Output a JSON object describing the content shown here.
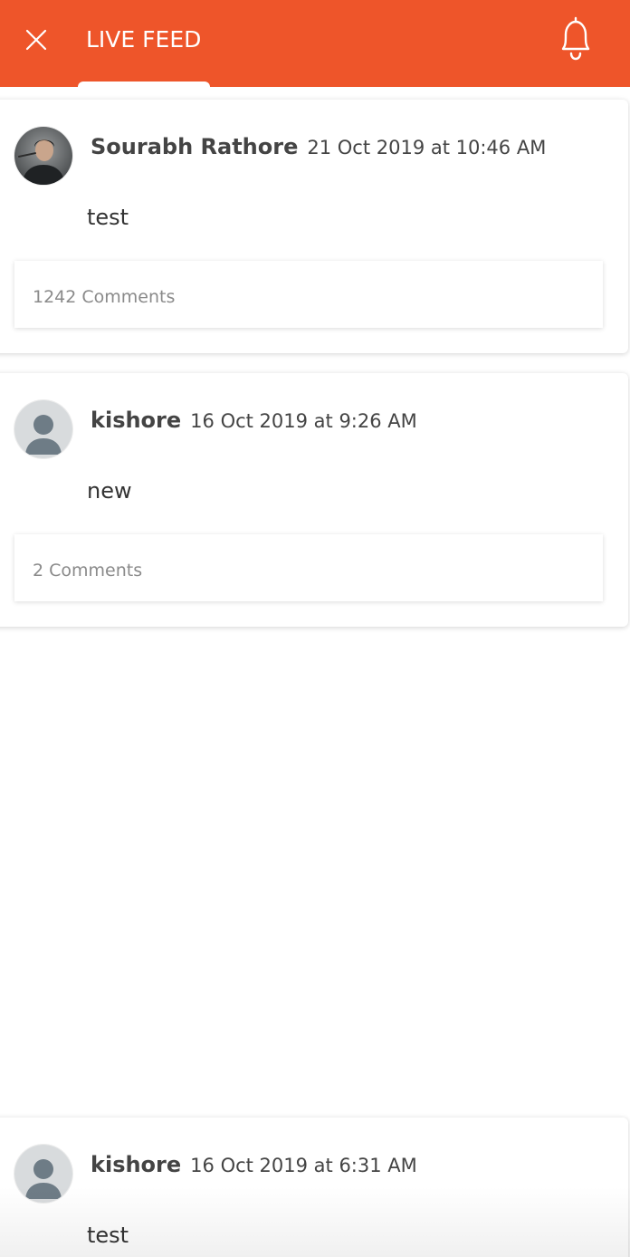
{
  "header": {
    "title": "LIVE FEED",
    "close_icon": "close-icon",
    "bell_icon": "bell-icon",
    "background": "#EE552A"
  },
  "feed": {
    "posts": [
      {
        "author": "Sourabh Rathore",
        "timestamp": "21 Oct 2019 at 10:46 AM",
        "text": "test",
        "comments": "1242 Comments",
        "avatar": "user-photo"
      },
      {
        "author": "kishore",
        "timestamp": "16 Oct 2019 at 9:26 AM",
        "text": "new",
        "comments": "2 Comments",
        "avatar": "default-user-icon"
      },
      {
        "author": "kishore",
        "timestamp": "16 Oct 2019 at 6:31 AM",
        "text": "test",
        "avatar": "default-user-icon"
      }
    ]
  }
}
